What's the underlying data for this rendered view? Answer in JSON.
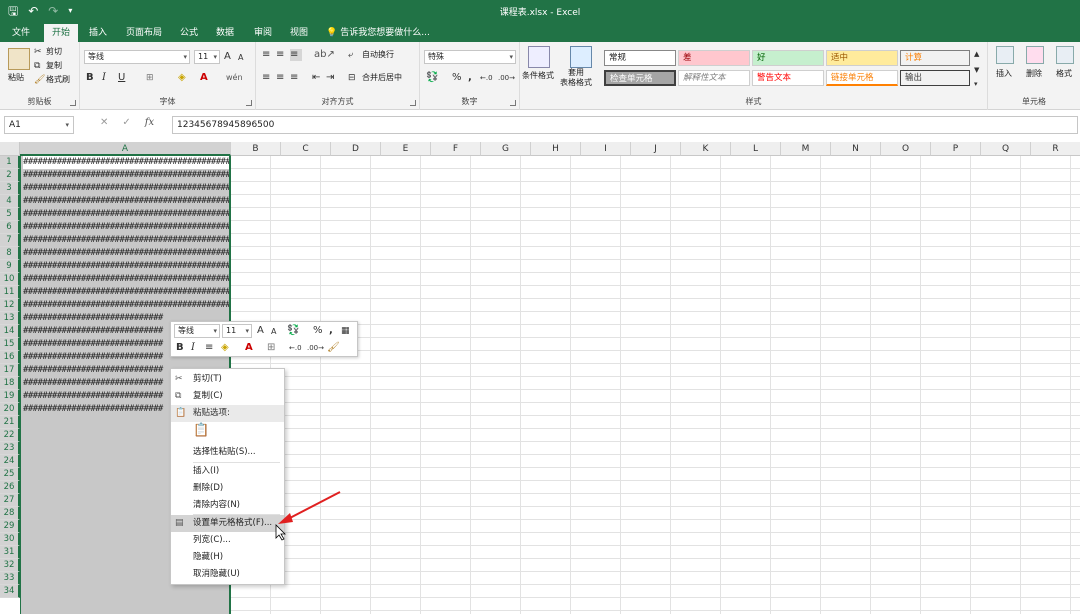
{
  "window": {
    "title": "课程表.xlsx - Excel"
  },
  "qat": {
    "save_icon": "save-icon",
    "undo_icon": "undo-icon",
    "redo_icon": "redo-icon",
    "more": "▾"
  },
  "tabs": [
    {
      "label": "文件"
    },
    {
      "label": "开始"
    },
    {
      "label": "插入"
    },
    {
      "label": "页面布局"
    },
    {
      "label": "公式"
    },
    {
      "label": "数据"
    },
    {
      "label": "审阅"
    },
    {
      "label": "视图"
    }
  ],
  "tell_me": "告诉我您想要做什么...",
  "ribbon": {
    "clipboard": {
      "label": "剪贴板",
      "paste": "粘贴",
      "cut": "剪切",
      "copy": "复制",
      "format_painter": "格式刷"
    },
    "font": {
      "label": "字体",
      "font_name": "等线",
      "font_size": "11",
      "bold": "B",
      "italic": "I",
      "underline": "U",
      "grow": "A",
      "shrink": "A"
    },
    "alignment": {
      "label": "对齐方式",
      "wrap": "自动换行",
      "merge": "合并后居中"
    },
    "number": {
      "label": "数字",
      "format": "特殊",
      "percent": "%",
      "comma": ","
    },
    "styles": {
      "label": "样式",
      "conditional": "条件格式",
      "table_format": "套用\n表格格式",
      "cells": [
        {
          "text": "常规"
        },
        {
          "text": "差"
        },
        {
          "text": "好"
        },
        {
          "text": "适中"
        },
        {
          "text": "计算"
        },
        {
          "text": "检查单元格"
        },
        {
          "text": "解释性文本"
        },
        {
          "text": "警告文本"
        },
        {
          "text": "链接单元格"
        },
        {
          "text": "输出"
        }
      ]
    },
    "cells": {
      "label": "单元格",
      "insert": "插入",
      "delete": "删除",
      "format": "格式"
    }
  },
  "formula_bar": {
    "name_box": "A1",
    "cancel": "✕",
    "enter": "✓",
    "fx": "fx",
    "value": "12345678945896500"
  },
  "columns": [
    "A",
    "B",
    "C",
    "D",
    "E",
    "F",
    "G",
    "H",
    "I",
    "J",
    "K",
    "L",
    "M",
    "N",
    "O",
    "P",
    "Q",
    "R"
  ],
  "rows": [
    "1",
    "2",
    "3",
    "4",
    "5",
    "6",
    "7",
    "8",
    "9",
    "10",
    "11",
    "12",
    "13",
    "14",
    "15",
    "16",
    "17",
    "18",
    "19",
    "20",
    "21",
    "22",
    "23",
    "24",
    "25",
    "26",
    "27",
    "28",
    "29",
    "30",
    "31",
    "32",
    "33",
    "34"
  ],
  "cell_a_values": [
    "############################################",
    "############################################",
    "############################################",
    "############################################",
    "############################################",
    "############################################",
    "############################################",
    "############################################",
    "############################################",
    "############################################",
    "############################################",
    "############################################",
    "#############################",
    "#############################",
    "#############################",
    "#############################",
    "#############################",
    "#############################",
    "#############################",
    "#############################"
  ],
  "mini_toolbar": {
    "font": "等线",
    "size": "11",
    "grow": "A",
    "shrink": "A",
    "percent": "%",
    "comma": ",",
    "bold": "B",
    "italic": "I"
  },
  "context_menu": {
    "cut": "剪切(T)",
    "copy": "复制(C)",
    "paste_options": "粘贴选项:",
    "paste_special": "选择性粘贴(S)...",
    "insert": "插入(I)",
    "delete": "删除(D)",
    "clear": "清除内容(N)",
    "format_cells": "设置单元格格式(F)...",
    "col_width": "列宽(C)...",
    "hide": "隐藏(H)",
    "unhide": "取消隐藏(U)"
  },
  "colors": {
    "accent": "#217346",
    "annotation_arrow": "#e02020"
  }
}
